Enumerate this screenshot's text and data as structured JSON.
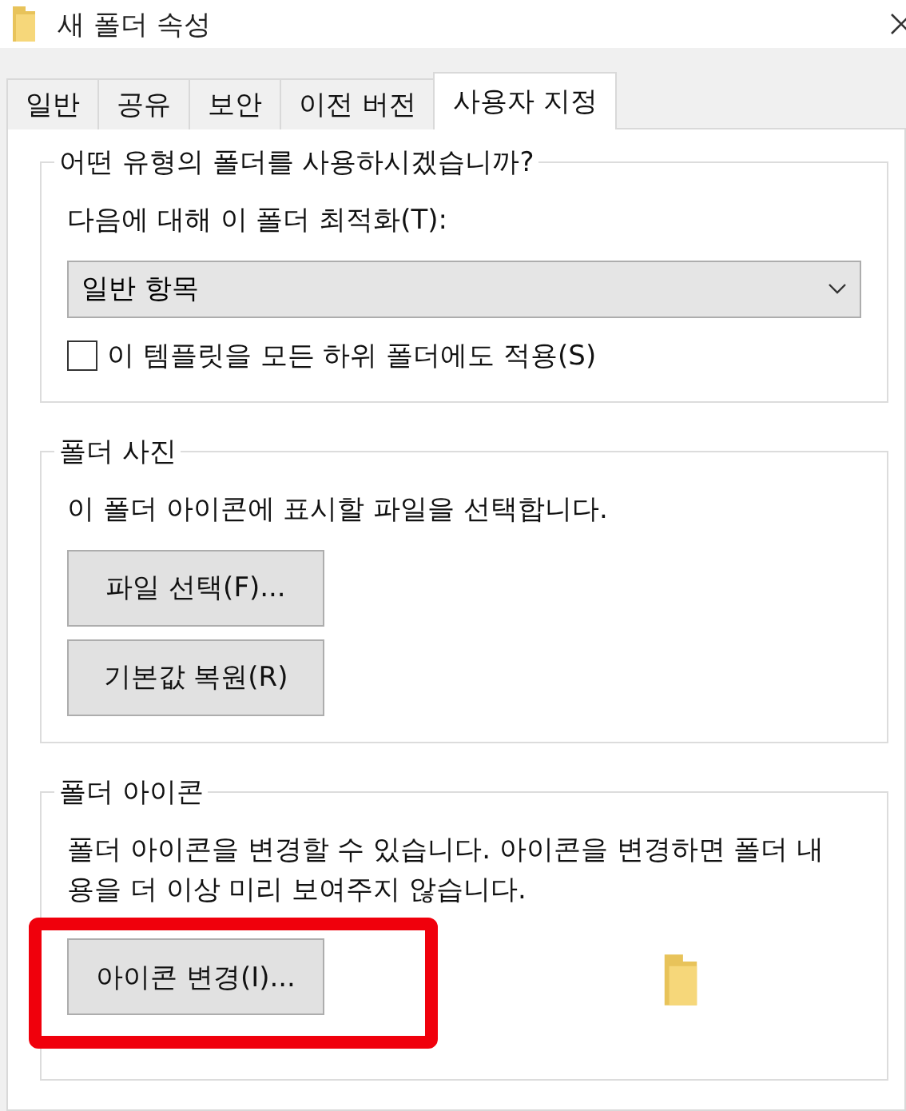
{
  "window": {
    "title": "새 폴더 속성"
  },
  "tabs": [
    {
      "label": "일반",
      "selected": false
    },
    {
      "label": "공유",
      "selected": false
    },
    {
      "label": "보안",
      "selected": false
    },
    {
      "label": "이전 버전",
      "selected": false
    },
    {
      "label": "사용자 지정",
      "selected": true
    }
  ],
  "folder_type": {
    "title": "어떤 유형의 폴더를 사용하시겠습니까?",
    "label": "다음에 대해 이 폴더 최적화(T):",
    "value": "일반 항목",
    "apply_label": "이 템플릿을 모든 하위 폴더에도 적용(S)",
    "apply_checked": false
  },
  "folder_picture": {
    "title": "폴더 사진",
    "description": "이 폴더 아이콘에 표시할 파일을 선택합니다.",
    "buttons": [
      "파일 선택(F)...",
      "기본값 복원(R)"
    ]
  },
  "folder_icon": {
    "title": "폴더 아이콘",
    "description": "폴더 아이콘을 변경할 수 있습니다. 아이콘을 변경하면 폴더 내용을 더 이상  미리 보여주지 않습니다.",
    "button": {
      "label": "아이콘 변경(I)...",
      "highlighted": true
    }
  }
}
